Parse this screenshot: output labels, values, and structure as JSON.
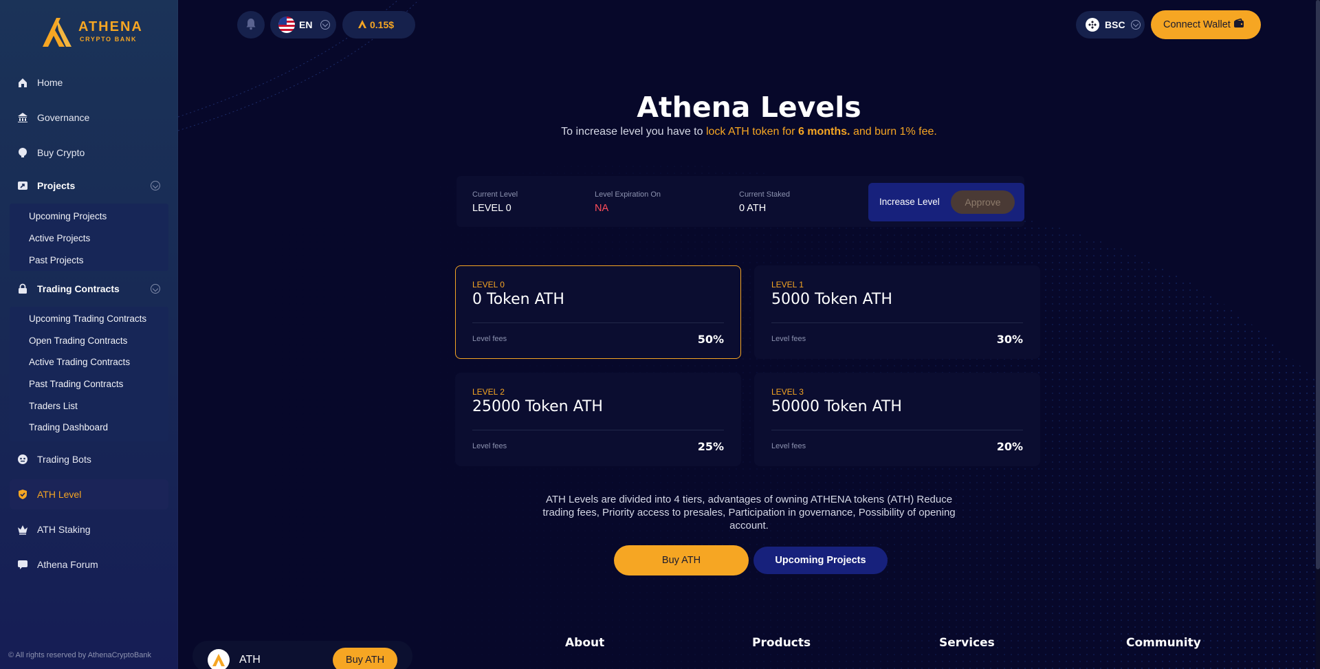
{
  "brand": {
    "name": "ATHENA",
    "tagline": "CRYPTO BANK",
    "copyright": "© All rights reserved by AthenaCryptoBank"
  },
  "colors": {
    "accent": "#f6a623",
    "background": "#07082a",
    "sidebar": "#182a55",
    "panel": "#0b0d30",
    "blue_button": "#17217c",
    "danger": "#ff4d5a"
  },
  "sidebar": {
    "items": [
      {
        "label": "Home",
        "icon": "home-icon"
      },
      {
        "label": "Governance",
        "icon": "bank-icon"
      },
      {
        "label": "Buy Crypto",
        "icon": "coin-icon"
      },
      {
        "label": "Projects",
        "icon": "projects-icon"
      },
      {
        "label": "Trading Contracts",
        "icon": "lock-icon"
      },
      {
        "label": "Trading Bots",
        "icon": "bot-icon"
      },
      {
        "label": "ATH Level",
        "icon": "shield-check-icon"
      },
      {
        "label": "ATH Staking",
        "icon": "crown-icon"
      },
      {
        "label": "Athena Forum",
        "icon": "chat-icon"
      }
    ],
    "projects_submenu": [
      "Upcoming Projects",
      "Active Projects",
      "Past Projects"
    ],
    "contracts_submenu": [
      "Upcoming Trading Contracts",
      "Open Trading Contracts",
      "Active Trading Contracts",
      "Past Trading Contracts",
      "Traders List",
      "Trading Dashboard"
    ]
  },
  "topbar": {
    "language": "EN",
    "token_price": "0.15$",
    "chain": "BSC",
    "connect_label": "Connect Wallet"
  },
  "main": {
    "title": "Athena Levels",
    "subtitle_prefix": "To increase level you have to",
    "subtitle_lock": "lock ATH token for",
    "subtitle_period": "6 months.",
    "subtitle_burn": "and burn 1% fee.",
    "status": {
      "current_level_label": "Current Level",
      "current_level": "LEVEL 0",
      "expiration_label": "Level Expiration On",
      "expiration": "NA",
      "staked_label": "Current Staked",
      "staked": "0 ATH",
      "increase_label": "Increase Level",
      "approve_label": "Approve"
    },
    "levels": [
      {
        "level": "LEVEL 0",
        "tokens": "0 Token ATH",
        "fee_label": "Level fees",
        "fee": "50%"
      },
      {
        "level": "LEVEL 1",
        "tokens": "5000 Token ATH",
        "fee_label": "Level fees",
        "fee": "30%"
      },
      {
        "level": "LEVEL 2",
        "tokens": "25000 Token ATH",
        "fee_label": "Level fees",
        "fee": "25%"
      },
      {
        "level": "LEVEL 3",
        "tokens": "50000 Token ATH",
        "fee_label": "Level fees",
        "fee": "20%"
      }
    ],
    "info": "ATH Levels are divided into 4 tiers, advantages of owning ATHENA tokens (ATH) Reduce trading fees, Priority access to presales, Participation in governance, Possibility of opening account.",
    "buy_label": "Buy ATH",
    "upcoming_label": "Upcoming Projects"
  },
  "footer": {
    "token": "ATH",
    "buy_label": "Buy ATH",
    "columns": [
      "About",
      "Products",
      "Services",
      "Community"
    ]
  }
}
